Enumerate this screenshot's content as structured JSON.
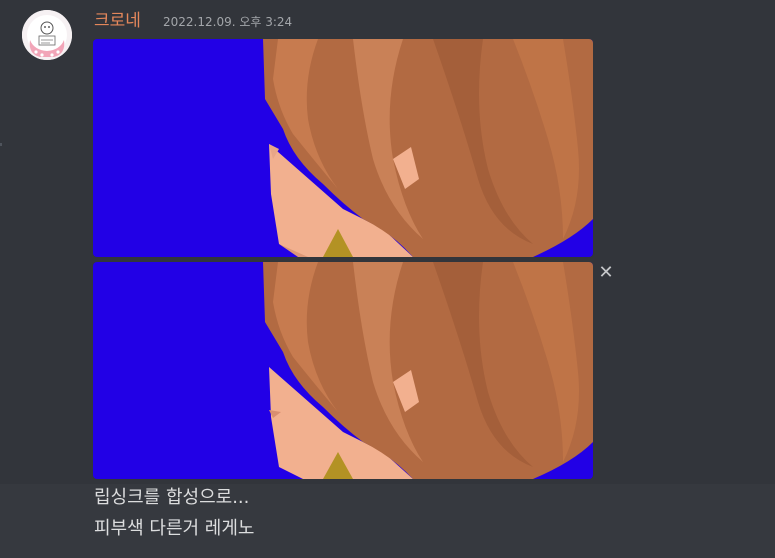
{
  "message": {
    "author": "크로네",
    "timestamp": "2022.12.09. 오후 3:24",
    "author_color": "#e4875b",
    "attachments": [
      {
        "icon": "image-attachment-1"
      },
      {
        "icon": "image-attachment-2",
        "remove_icon": "close-icon"
      }
    ],
    "remove_glyph": "✕",
    "lines": [
      "립싱크를 합성으로...",
      "피부색 다른거 레게노"
    ]
  },
  "colors": {
    "background": "#36393f",
    "hover_background": "#32353b",
    "image_background": "#2200e6",
    "hair": "#b26a42",
    "skin": "#f2b08f"
  }
}
